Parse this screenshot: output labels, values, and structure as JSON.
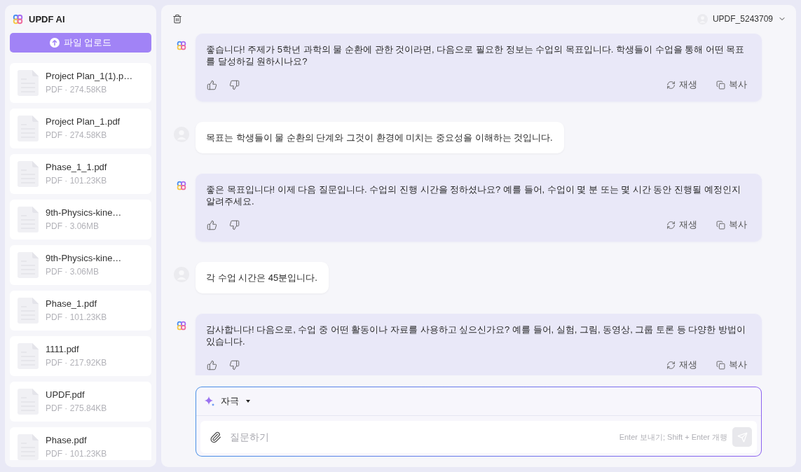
{
  "sidebar": {
    "app_title": "UPDF AI",
    "upload_button": "파일 업로드",
    "files": [
      {
        "name": "Project Plan_1(1).p…",
        "meta": "PDF · 274.58KB"
      },
      {
        "name": "Project Plan_1.pdf",
        "meta": "PDF · 274.58KB"
      },
      {
        "name": "Phase_1_1.pdf",
        "meta": "PDF · 101.23KB"
      },
      {
        "name": "9th-Physics-kine…",
        "meta": "PDF · 3.06MB"
      },
      {
        "name": "9th-Physics-kine…",
        "meta": "PDF · 3.06MB"
      },
      {
        "name": "Phase_1.pdf",
        "meta": "PDF · 101.23KB"
      },
      {
        "name": "1111.pdf",
        "meta": "PDF · 217.92KB"
      },
      {
        "name": "UPDF.pdf",
        "meta": "PDF · 275.84KB"
      },
      {
        "name": "Phase.pdf",
        "meta": "PDF · 101.23KB"
      }
    ]
  },
  "header": {
    "user_name": "UPDF_5243709"
  },
  "messages": [
    {
      "kind": "ai",
      "text": "좋습니다! 주제가 5학년 과학의 물 순환에 관한 것이라면, 다음으로 필요한 정보는 수업의 목표입니다. 학생들이 수업을 통해 어떤 목표를 달성하길 원하시나요?",
      "regenerate_label": "재생",
      "copy_label": "복사"
    },
    {
      "kind": "user",
      "text": "목표는 학생들이 물 순환의 단계와 그것이 환경에 미치는 중요성을 이해하는 것입니다."
    },
    {
      "kind": "ai",
      "text": "좋은 목표입니다! 이제 다음 질문입니다. 수업의 진행 시간을 정하셨나요? 예를 들어, 수업이 몇 분 또는 몇 시간 동안 진행될 예정인지 알려주세요.",
      "regenerate_label": "재생",
      "copy_label": "복사"
    },
    {
      "kind": "user",
      "text": "각 수업 시간은 45분입니다."
    },
    {
      "kind": "ai",
      "text": "감사합니다! 다음으로, 수업 중 어떤 활동이나 자료를 사용하고 싶으신가요? 예를 들어, 실험, 그림, 동영상, 그룹 토론 등 다양한 방법이 있습니다.",
      "regenerate_label": "재생",
      "copy_label": "복사"
    }
  ],
  "composer": {
    "mode": "자극",
    "placeholder": "질문하기",
    "hint": "Enter 보내기; Shift + Enter 개행",
    "send_button": {
      "disabled": true
    }
  }
}
